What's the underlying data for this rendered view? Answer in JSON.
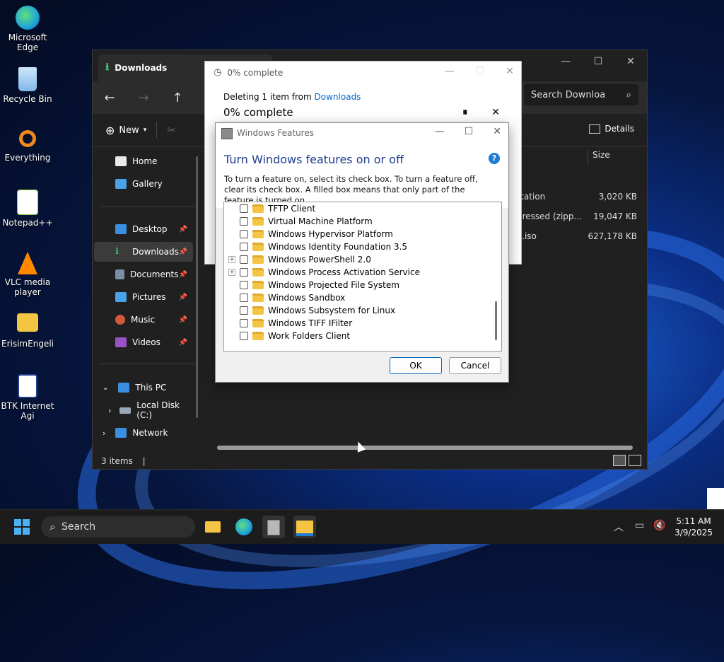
{
  "desktop": {
    "icons": [
      {
        "label": "Microsoft Edge",
        "color": "#1fa3d9"
      },
      {
        "label": "Recycle Bin",
        "color": "#7fb8e8"
      },
      {
        "label": "Everything",
        "color": "#f08a1a"
      },
      {
        "label": "Notepad++",
        "color": "#8bc34a"
      },
      {
        "label": "VLC media player",
        "color": "#ff8800"
      },
      {
        "label": "ErisimEngeli",
        "color": "#f4c542"
      },
      {
        "label": "BTK Internet Agi",
        "color": "#1d3d8f"
      }
    ]
  },
  "explorer": {
    "tab_title": "Downloads",
    "search_placeholder": "Search Downloa",
    "new_label": "New",
    "details_label": "Details",
    "sidebar": {
      "home": "Home",
      "gallery": "Gallery",
      "desktop": "Desktop",
      "downloads": "Downloads",
      "documents": "Documents",
      "pictures": "Pictures",
      "music": "Music",
      "videos": "Videos",
      "this_pc": "This PC",
      "local_disk": "Local Disk (C:)",
      "network": "Network"
    },
    "column_size": "Size",
    "files": [
      {
        "name": "ication",
        "size": "3,020 KB"
      },
      {
        "name": "pressed (zipp...",
        "size": "19,047 KB"
      },
      {
        "name": "o.iso",
        "size": "627,178 KB"
      }
    ],
    "status": "3 items"
  },
  "progress_dialog": {
    "title": "0% complete",
    "deleting_prefix": "Deleting 1 item from ",
    "deleting_link": "Downloads",
    "percent_text": "0% complete"
  },
  "features_dialog": {
    "title": "Windows Features",
    "heading": "Turn Windows features on or off",
    "help_label": "?",
    "description": "To turn a feature on, select its check box. To turn a feature off, clear its check box. A filled box means that only part of the feature is turned on.",
    "items": [
      {
        "label": "TFTP Client",
        "expandable": false
      },
      {
        "label": "Virtual Machine Platform",
        "expandable": false
      },
      {
        "label": "Windows Hypervisor Platform",
        "expandable": false
      },
      {
        "label": "Windows Identity Foundation 3.5",
        "expandable": false
      },
      {
        "label": "Windows PowerShell 2.0",
        "expandable": true
      },
      {
        "label": "Windows Process Activation Service",
        "expandable": true
      },
      {
        "label": "Windows Projected File System",
        "expandable": false
      },
      {
        "label": "Windows Sandbox",
        "expandable": false
      },
      {
        "label": "Windows Subsystem for Linux",
        "expandable": false
      },
      {
        "label": "Windows TIFF IFilter",
        "expandable": false
      },
      {
        "label": "Work Folders Client",
        "expandable": false
      }
    ],
    "ok_label": "OK",
    "cancel_label": "Cancel"
  },
  "taskbar": {
    "search_label": "Search",
    "time": "5:11 AM",
    "date": "3/9/2025"
  }
}
